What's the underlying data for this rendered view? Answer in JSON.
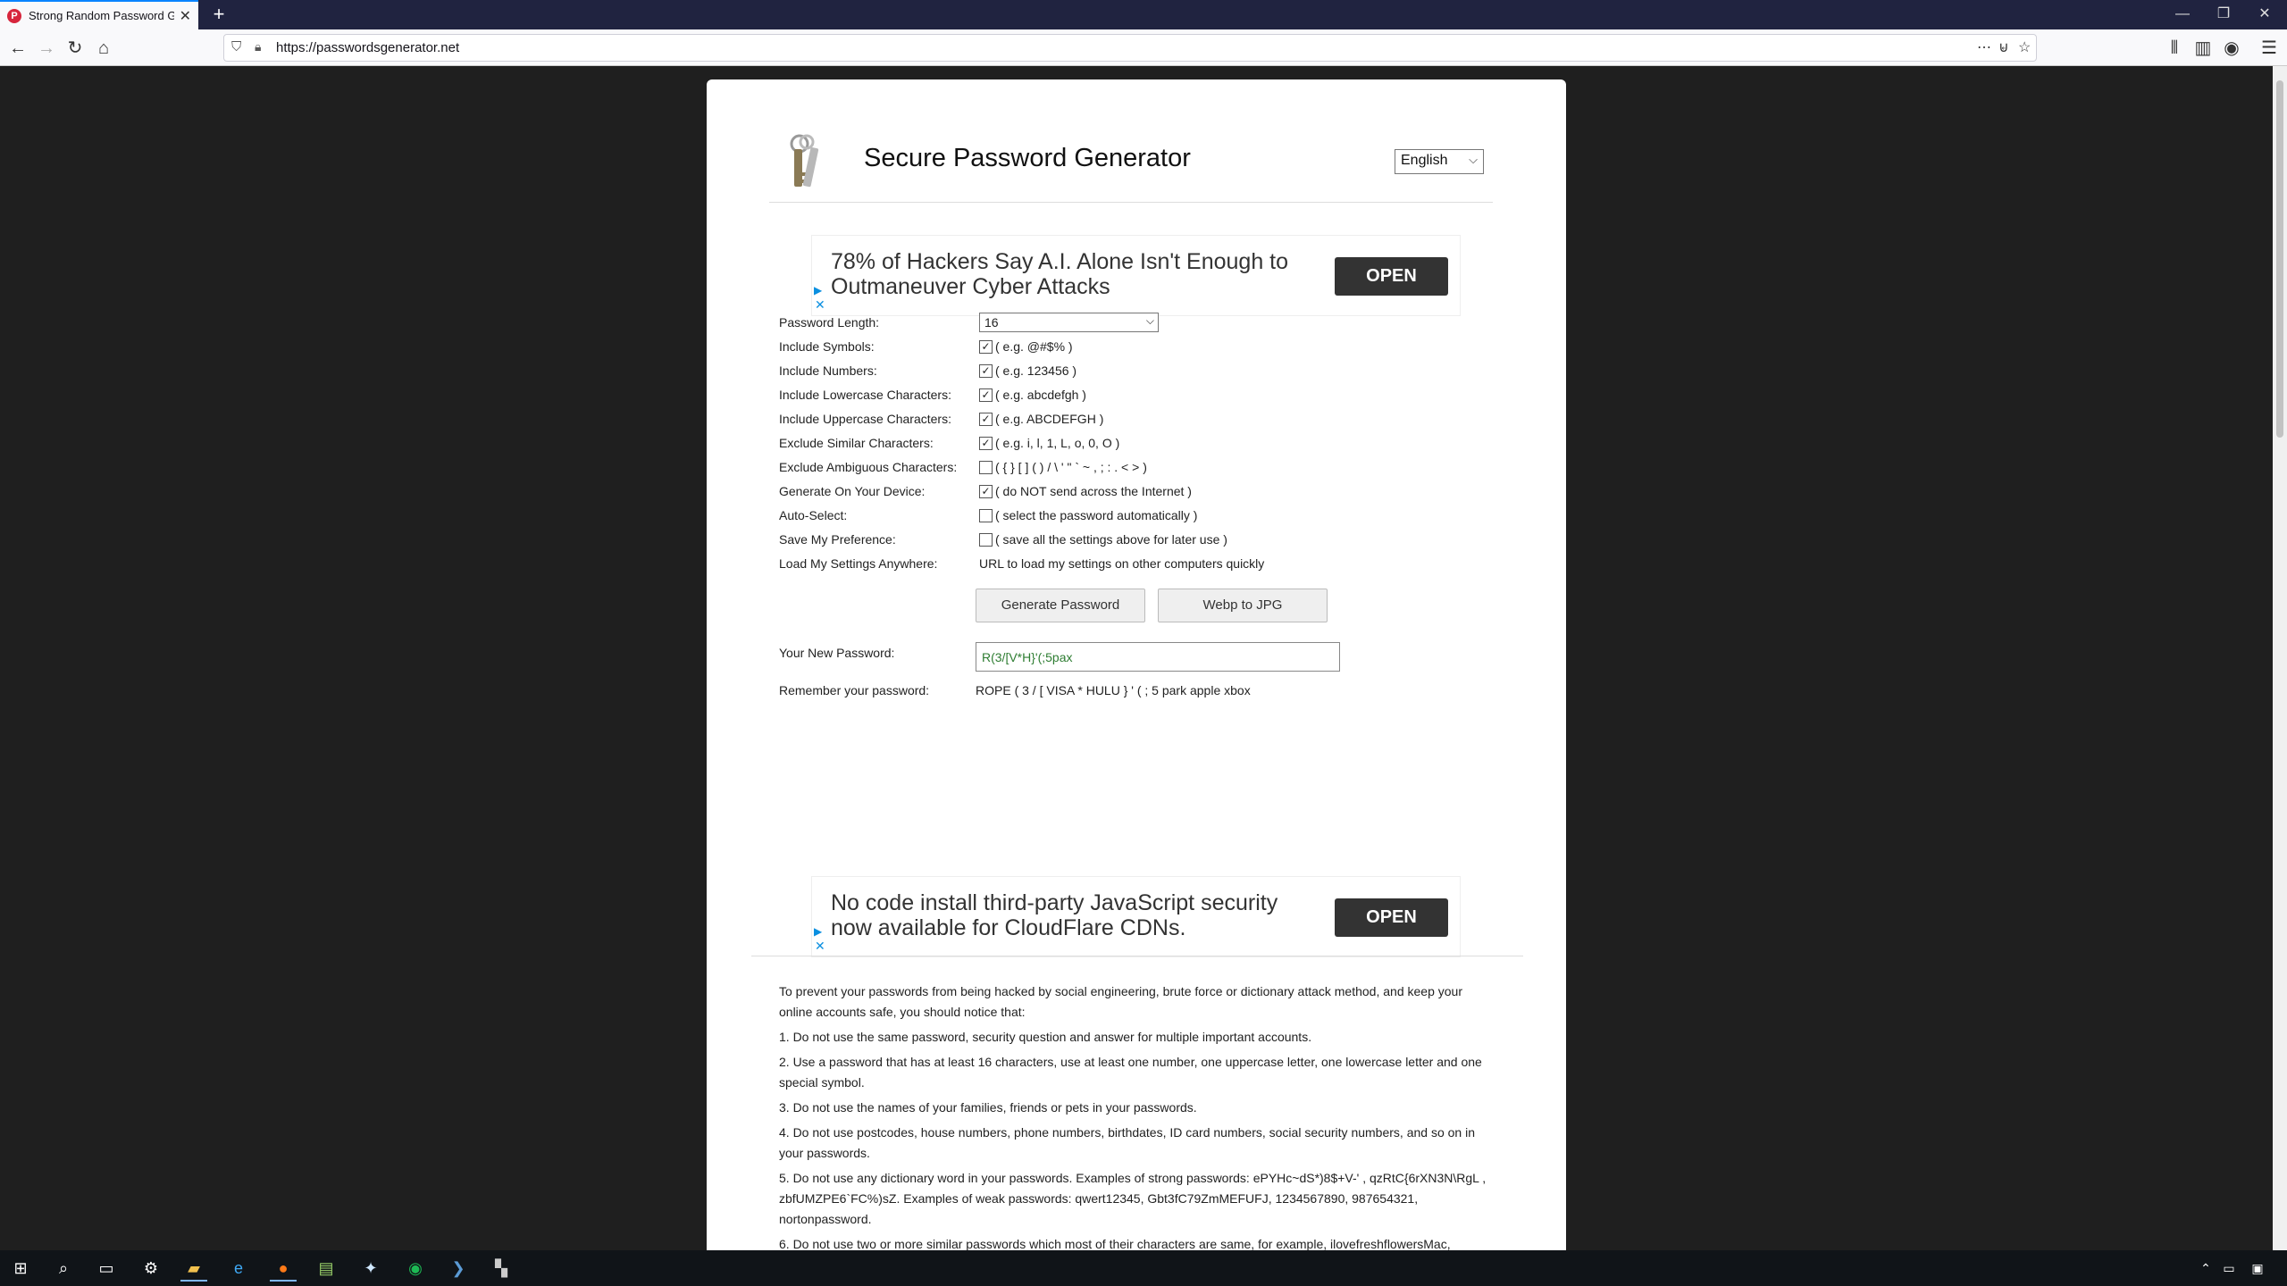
{
  "browser": {
    "tab_title": "Strong Random Password Generator",
    "tab_favicon": "P",
    "url": "https://passwordsgenerator.net",
    "newtab": "+",
    "tab_close": "✕"
  },
  "page": {
    "title": "Secure Password Generator",
    "language": "English",
    "ads": [
      {
        "text": "78% of Hackers Say A.I. Alone Isn't Enough to Outmaneuver Cyber Attacks",
        "button": "OPEN"
      },
      {
        "text": "No code install third-party JavaScript security now available for CloudFlare CDNs.",
        "button": "OPEN"
      }
    ],
    "form": {
      "length_label": "Password Length:",
      "length_value": "16",
      "options": [
        {
          "label": "Include Symbols:",
          "checked": true,
          "desc": "( e.g. @#$% )"
        },
        {
          "label": "Include Numbers:",
          "checked": true,
          "desc": "( e.g. 123456 )"
        },
        {
          "label": "Include Lowercase Characters:",
          "checked": true,
          "desc": "( e.g. abcdefgh )"
        },
        {
          "label": "Include Uppercase Characters:",
          "checked": true,
          "desc": "( e.g. ABCDEFGH )"
        },
        {
          "label": "Exclude Similar Characters:",
          "checked": true,
          "desc": "( e.g. i, l, 1, L, o, 0, O )"
        },
        {
          "label": "Exclude Ambiguous Characters:",
          "checked": false,
          "desc": "( { } [ ] ( ) / \\ ' \" ` ~ , ; : . < > )"
        },
        {
          "label": "Generate On Your Device:",
          "checked": true,
          "desc": "( do NOT send across the Internet )"
        },
        {
          "label": "Auto-Select:",
          "checked": false,
          "desc": "( select the password automatically )"
        },
        {
          "label": "Save My Preference:",
          "checked": false,
          "desc": "( save all the settings above for later use )"
        }
      ],
      "load_label": "Load My Settings Anywhere:",
      "load_desc": "URL to load my settings on other computers quickly",
      "generate_button": "Generate Password",
      "webp_button": "Webp to JPG",
      "new_password_label": "Your New Password:",
      "new_password_value": "R(3/[V*H}'(;5pax",
      "remember_label": "Remember your password:",
      "remember_value": "ROPE ( 3 / [ VISA * HULU } ' ( ; 5 park apple xbox"
    },
    "tips": [
      "To prevent your passwords from being hacked by social engineering, brute force or dictionary attack method, and keep your online accounts safe, you should notice that:",
      "1. Do not use the same password, security question and answer for multiple important accounts.",
      "2. Use a password that has at least 16 characters, use at least one number, one uppercase letter, one lowercase letter and one special symbol.",
      "3. Do not use the names of your families, friends or pets in your passwords.",
      "4. Do not use postcodes, house numbers, phone numbers, birthdates, ID card numbers, social security numbers, and so on in your passwords.",
      "5. Do not use any dictionary word in your passwords. Examples of strong passwords: ePYHc~dS*)8$+V-' , qzRtC{6rXN3N\\RgL , zbfUMZPE6`FC%)sZ. Examples of weak passwords: qwert12345, Gbt3fC79ZmMEFUFJ, 1234567890, 987654321, nortonpassword.",
      "6. Do not use two or more similar passwords which most of their characters are same, for example, ilovefreshflowersMac,"
    ]
  },
  "taskbar": {
    "icons": [
      "windows-start-icon",
      "search-icon",
      "task-view-icon",
      "settings-icon",
      "file-explorer-icon",
      "edge-icon",
      "firefox-icon",
      "notepad-icon",
      "app-icon",
      "spotify-icon",
      "powershell-icon",
      "terminal-icon"
    ]
  },
  "colors": {
    "accent": "#0a84ff",
    "password_text": "#2e7d32",
    "ad_button": "#333333"
  }
}
